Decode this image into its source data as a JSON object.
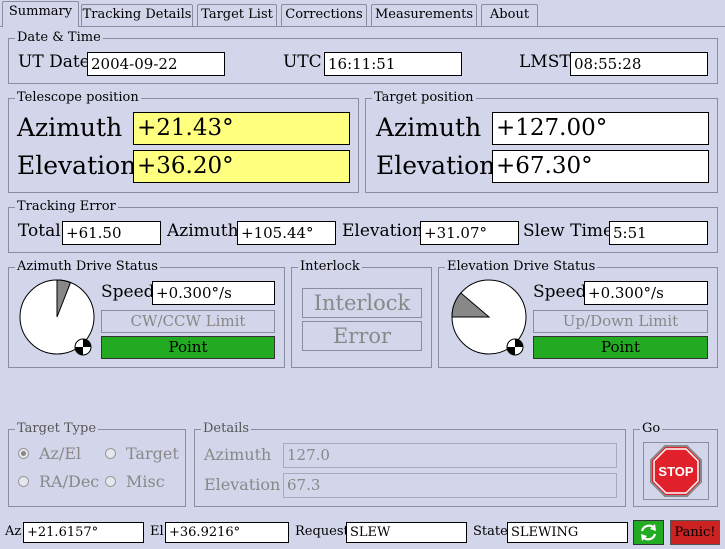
{
  "tabs": [
    "Summary",
    "Tracking Details",
    "Target List",
    "Corrections",
    "Measurements",
    "About"
  ],
  "datetime": {
    "title": "Date & Time",
    "ut_date_label": "UT Date",
    "ut_date": "2004-09-22",
    "utc_label": "UTC",
    "utc": "16:11:51",
    "lmst_label": "LMST",
    "lmst": "08:55:28"
  },
  "telescope": {
    "title": "Telescope position",
    "azimuth_label": "Azimuth",
    "azimuth": "+21.43°",
    "elevation_label": "Elevation",
    "elevation": "+36.20°"
  },
  "target": {
    "title": "Target position",
    "azimuth_label": "Azimuth",
    "azimuth": "+127.00°",
    "elevation_label": "Elevation",
    "elevation": "+67.30°"
  },
  "tracking_error": {
    "title": "Tracking Error",
    "total_label": "Total",
    "total": "+61.50",
    "azimuth_label": "Azimuth",
    "azimuth": "+105.44°",
    "elevation_label": "Elevation",
    "elevation": "+31.07°",
    "slew_label": "Slew Time",
    "slew": "5:51"
  },
  "az_drive": {
    "title": "Azimuth Drive Status",
    "speed_label": "Speed",
    "speed": "+0.300°/s",
    "limit_label": "CW/CCW Limit",
    "point_label": "Point"
  },
  "interlock": {
    "title": "Interlock",
    "interlock_label": "Interlock",
    "error_label": "Error"
  },
  "el_drive": {
    "title": "Elevation Drive Status",
    "speed_label": "Speed",
    "speed": "+0.300°/s",
    "limit_label": "Up/Down Limit",
    "point_label": "Point"
  },
  "target_type": {
    "title": "Target Type",
    "options": [
      "Az/El",
      "Target",
      "RA/Dec",
      "Misc"
    ],
    "selected": "Az/El"
  },
  "details": {
    "title": "Details",
    "azimuth_label": "Azimuth",
    "azimuth": "127.0",
    "elevation_label": "Elevation",
    "elevation": "67.3"
  },
  "go": {
    "title": "Go",
    "stop_label": "STOP"
  },
  "status_bar": {
    "az_label": "Az",
    "az": "+21.6157°",
    "el_label": "El",
    "el": "+36.9216°",
    "request_label": "Request",
    "request": "SLEW",
    "state_label": "State",
    "state": "SLEWING",
    "panic_label": "Panic!"
  },
  "colors": {
    "background": "#d3d6ea",
    "highlight_yellow": "#ffff80",
    "point_green": "#22aa22",
    "stop_red": "#e0202a",
    "panic_red": "#cc2222"
  }
}
